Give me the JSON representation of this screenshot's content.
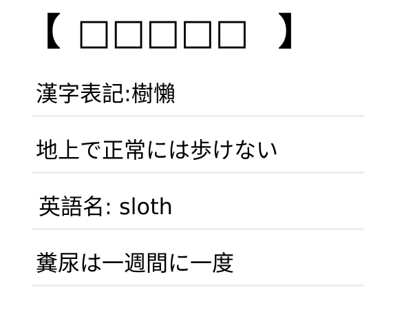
{
  "heading": {
    "open_bracket": "【",
    "title": "□□□□□",
    "close_bracket": "】"
  },
  "facts": [
    "漢字表記:樹懶",
    "地上で正常には歩けない",
    "英語名: sloth",
    "糞尿は一週間に一度"
  ]
}
